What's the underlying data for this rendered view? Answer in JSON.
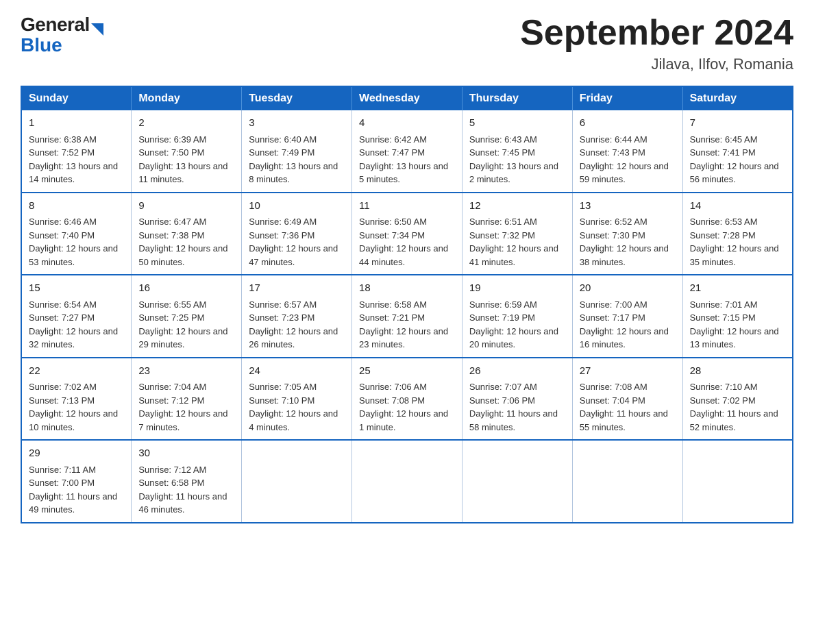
{
  "header": {
    "logo_general": "General",
    "logo_blue": "Blue",
    "title": "September 2024",
    "subtitle": "Jilava, Ilfov, Romania"
  },
  "weekdays": [
    "Sunday",
    "Monday",
    "Tuesday",
    "Wednesday",
    "Thursday",
    "Friday",
    "Saturday"
  ],
  "weeks": [
    [
      {
        "day": "1",
        "sunrise": "6:38 AM",
        "sunset": "7:52 PM",
        "daylight": "13 hours and 14 minutes."
      },
      {
        "day": "2",
        "sunrise": "6:39 AM",
        "sunset": "7:50 PM",
        "daylight": "13 hours and 11 minutes."
      },
      {
        "day": "3",
        "sunrise": "6:40 AM",
        "sunset": "7:49 PM",
        "daylight": "13 hours and 8 minutes."
      },
      {
        "day": "4",
        "sunrise": "6:42 AM",
        "sunset": "7:47 PM",
        "daylight": "13 hours and 5 minutes."
      },
      {
        "day": "5",
        "sunrise": "6:43 AM",
        "sunset": "7:45 PM",
        "daylight": "13 hours and 2 minutes."
      },
      {
        "day": "6",
        "sunrise": "6:44 AM",
        "sunset": "7:43 PM",
        "daylight": "12 hours and 59 minutes."
      },
      {
        "day": "7",
        "sunrise": "6:45 AM",
        "sunset": "7:41 PM",
        "daylight": "12 hours and 56 minutes."
      }
    ],
    [
      {
        "day": "8",
        "sunrise": "6:46 AM",
        "sunset": "7:40 PM",
        "daylight": "12 hours and 53 minutes."
      },
      {
        "day": "9",
        "sunrise": "6:47 AM",
        "sunset": "7:38 PM",
        "daylight": "12 hours and 50 minutes."
      },
      {
        "day": "10",
        "sunrise": "6:49 AM",
        "sunset": "7:36 PM",
        "daylight": "12 hours and 47 minutes."
      },
      {
        "day": "11",
        "sunrise": "6:50 AM",
        "sunset": "7:34 PM",
        "daylight": "12 hours and 44 minutes."
      },
      {
        "day": "12",
        "sunrise": "6:51 AM",
        "sunset": "7:32 PM",
        "daylight": "12 hours and 41 minutes."
      },
      {
        "day": "13",
        "sunrise": "6:52 AM",
        "sunset": "7:30 PM",
        "daylight": "12 hours and 38 minutes."
      },
      {
        "day": "14",
        "sunrise": "6:53 AM",
        "sunset": "7:28 PM",
        "daylight": "12 hours and 35 minutes."
      }
    ],
    [
      {
        "day": "15",
        "sunrise": "6:54 AM",
        "sunset": "7:27 PM",
        "daylight": "12 hours and 32 minutes."
      },
      {
        "day": "16",
        "sunrise": "6:55 AM",
        "sunset": "7:25 PM",
        "daylight": "12 hours and 29 minutes."
      },
      {
        "day": "17",
        "sunrise": "6:57 AM",
        "sunset": "7:23 PM",
        "daylight": "12 hours and 26 minutes."
      },
      {
        "day": "18",
        "sunrise": "6:58 AM",
        "sunset": "7:21 PM",
        "daylight": "12 hours and 23 minutes."
      },
      {
        "day": "19",
        "sunrise": "6:59 AM",
        "sunset": "7:19 PM",
        "daylight": "12 hours and 20 minutes."
      },
      {
        "day": "20",
        "sunrise": "7:00 AM",
        "sunset": "7:17 PM",
        "daylight": "12 hours and 16 minutes."
      },
      {
        "day": "21",
        "sunrise": "7:01 AM",
        "sunset": "7:15 PM",
        "daylight": "12 hours and 13 minutes."
      }
    ],
    [
      {
        "day": "22",
        "sunrise": "7:02 AM",
        "sunset": "7:13 PM",
        "daylight": "12 hours and 10 minutes."
      },
      {
        "day": "23",
        "sunrise": "7:04 AM",
        "sunset": "7:12 PM",
        "daylight": "12 hours and 7 minutes."
      },
      {
        "day": "24",
        "sunrise": "7:05 AM",
        "sunset": "7:10 PM",
        "daylight": "12 hours and 4 minutes."
      },
      {
        "day": "25",
        "sunrise": "7:06 AM",
        "sunset": "7:08 PM",
        "daylight": "12 hours and 1 minute."
      },
      {
        "day": "26",
        "sunrise": "7:07 AM",
        "sunset": "7:06 PM",
        "daylight": "11 hours and 58 minutes."
      },
      {
        "day": "27",
        "sunrise": "7:08 AM",
        "sunset": "7:04 PM",
        "daylight": "11 hours and 55 minutes."
      },
      {
        "day": "28",
        "sunrise": "7:10 AM",
        "sunset": "7:02 PM",
        "daylight": "11 hours and 52 minutes."
      }
    ],
    [
      {
        "day": "29",
        "sunrise": "7:11 AM",
        "sunset": "7:00 PM",
        "daylight": "11 hours and 49 minutes."
      },
      {
        "day": "30",
        "sunrise": "7:12 AM",
        "sunset": "6:58 PM",
        "daylight": "11 hours and 46 minutes."
      },
      null,
      null,
      null,
      null,
      null
    ]
  ]
}
